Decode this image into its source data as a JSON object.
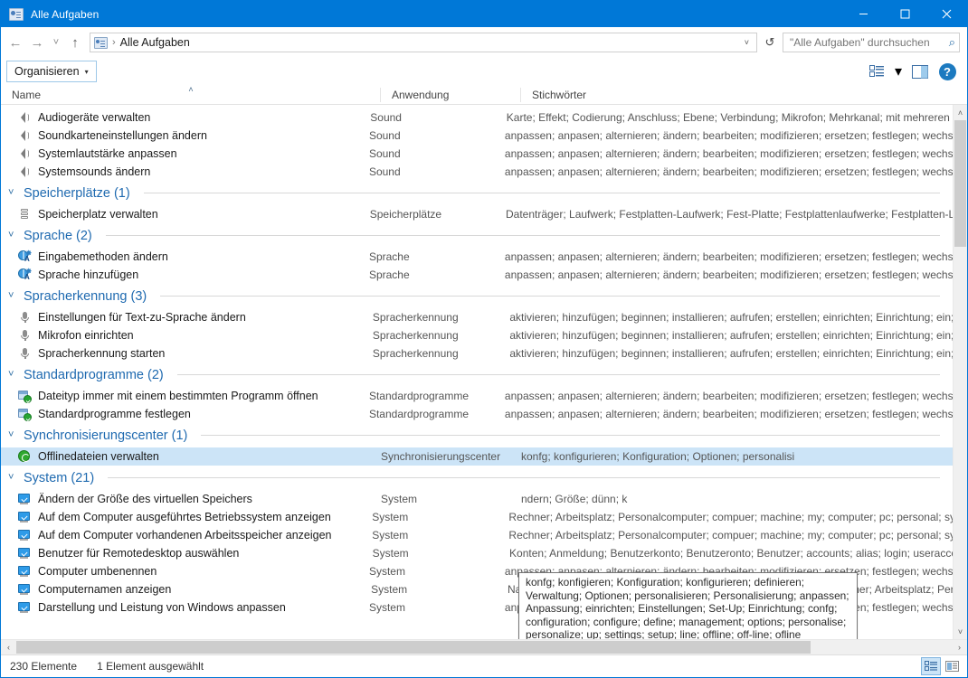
{
  "window": {
    "title": "Alle Aufgaben",
    "icon": "task-list-icon",
    "accent": "#0078d7",
    "minimize": "–",
    "maximize": "□",
    "close": "✕"
  },
  "addressbar": {
    "back": "←",
    "forward": "→",
    "recent": "˅",
    "up": "↑",
    "breadcrumb_icon": "task-list-icon",
    "separator": "›",
    "path": "Alle Aufgaben",
    "dropdown": "˅",
    "refresh": "↺",
    "search_placeholder": "\"Alle Aufgaben\" durchsuchen",
    "search_value": "",
    "search_icon": "⌕"
  },
  "toolbar": {
    "organize_label": "Organisieren",
    "organize_caret": "▾",
    "view_icon": "view-options-icon",
    "view_caret": "▾",
    "preview_icon": "preview-pane-icon",
    "help_icon": "?"
  },
  "columns": [
    {
      "label": "Name",
      "sorted": true,
      "sort_arrow": "˄"
    },
    {
      "label": "Anwendung",
      "sorted": false,
      "sort_arrow": ""
    },
    {
      "label": "Stichwörter",
      "sorted": false,
      "sort_arrow": ""
    }
  ],
  "chevron_group": "˅",
  "groups": [
    {
      "label": "",
      "header": false,
      "rows": [
        {
          "icon": "speaker",
          "name": "Audiogeräte verwalten",
          "app": "Sound",
          "keywords": "Karte; Effekt; Codierung; Anschluss; Ebene; Verbindung; Mikrofon; Mehrkanal; mit mehreren Kä"
        },
        {
          "icon": "speaker",
          "name": "Soundkarteneinstellungen ändern",
          "app": "Sound",
          "keywords": "anpassen; anpasen; alternieren; ändern; bearbeiten; modifizieren; ersetzen; festlegen; wechseln"
        },
        {
          "icon": "speaker",
          "name": "Systemlautstärke anpassen",
          "app": "Sound",
          "keywords": "anpassen; anpasen; alternieren; ändern; bearbeiten; modifizieren; ersetzen; festlegen; wechseln"
        },
        {
          "icon": "speaker",
          "name": "Systemsounds ändern",
          "app": "Sound",
          "keywords": "anpassen; anpasen; alternieren; ändern; bearbeiten; modifizieren; ersetzen; festlegen; wechseln"
        }
      ]
    },
    {
      "label": "Speicherplätze (1)",
      "header": true,
      "rows": [
        {
          "icon": "drive",
          "name": "Speicherplatz verwalten",
          "app": "Speicherplätze",
          "keywords": "Datenträger; Laufwerk; Festplatten-Laufwerk; Fest-Platte; Festplattenlaufwerke; Festplatten-Lau"
        }
      ]
    },
    {
      "label": "Sprache (2)",
      "header": true,
      "rows": [
        {
          "icon": "lang",
          "name": "Eingabemethoden ändern",
          "app": "Sprache",
          "keywords": "anpassen; anpasen; alternieren; ändern; bearbeiten; modifizieren; ersetzen; festlegen; wechseln"
        },
        {
          "icon": "lang",
          "name": "Sprache hinzufügen",
          "app": "Sprache",
          "keywords": "anpassen; anpasen; alternieren; ändern; bearbeiten; modifizieren; ersetzen; festlegen; wechseln"
        }
      ]
    },
    {
      "label": "Spracherkennung (3)",
      "header": true,
      "rows": [
        {
          "icon": "mic",
          "name": "Einstellungen für Text-zu-Sprache ändern",
          "app": "Spracherkennung",
          "keywords": "aktivieren; hinzufügen; beginnen; installieren; aufrufen; erstellen; einrichten; Einrichtung; ein; a"
        },
        {
          "icon": "mic",
          "name": "Mikrofon einrichten",
          "app": "Spracherkennung",
          "keywords": "aktivieren; hinzufügen; beginnen; installieren; aufrufen; erstellen; einrichten; Einrichtung; ein; a"
        },
        {
          "icon": "mic",
          "name": "Spracherkennung starten",
          "app": "Spracherkennung",
          "keywords": "aktivieren; hinzufügen; beginnen; installieren; aufrufen; erstellen; einrichten; Einrichtung; ein; a"
        }
      ]
    },
    {
      "label": "Standardprogramme (2)",
      "header": true,
      "rows": [
        {
          "icon": "defprog",
          "name": "Dateityp immer mit einem bestimmten Programm öffnen",
          "app": "Standardprogramme",
          "keywords": "anpassen; anpasen; alternieren; ändern; bearbeiten; modifizieren; ersetzen; festlegen; wechseln"
        },
        {
          "icon": "defprog",
          "name": "Standardprogramme festlegen",
          "app": "Standardprogramme",
          "keywords": "anpassen; anpasen; alternieren; ändern; bearbeiten; modifizieren; ersetzen; festlegen; wechseln"
        }
      ]
    },
    {
      "label": "Synchronisierungscenter (1)",
      "header": true,
      "rows": [
        {
          "icon": "sync",
          "name": "Offlinedateien verwalten",
          "app": "Synchronisierungscenter",
          "keywords": "konfg; konfigurieren; Konfiguration; Optionen; personalisi",
          "selected": true
        }
      ]
    },
    {
      "label": "System (21)",
      "header": true,
      "rows": [
        {
          "icon": "sysmon",
          "name": "Ändern der Größe des virtuellen Speichers",
          "app": "System",
          "keywords": "ndern; Größe; dünn; k"
        },
        {
          "icon": "sysmon",
          "name": "Auf dem Computer ausgeführtes Betriebssystem anzeigen",
          "app": "System",
          "keywords": "Rechner; Arbeitsplatz; Personalcomputer; compuer; machine; my; computer; pc; personal; syst"
        },
        {
          "icon": "sysmon",
          "name": "Auf dem Computer vorhandenen Arbeitsspeicher anzeigen",
          "app": "System",
          "keywords": "Rechner; Arbeitsplatz; Personalcomputer; compuer; machine; my; computer; pc; personal; syst"
        },
        {
          "icon": "sysmon",
          "name": "Benutzer für Remotedesktop auswählen",
          "app": "System",
          "keywords": "Konten; Anmeldung; Benutzerkonto; Benutzeronto; Benutzer; accounts; alias; login; useraccou"
        },
        {
          "icon": "sysmon",
          "name": "Computer umbenennen",
          "app": "System",
          "keywords": "anpassen; anpasen; alternieren; ändern; bearbeiten; modifizieren; ersetzen; festlegen; wechseln"
        },
        {
          "icon": "sysmon",
          "name": "Computernamen anzeigen",
          "app": "System",
          "keywords": "Namen; umbenennen; Umbenennung; names; rename; renaming; Rechner; Arbeitsplatz; Persc"
        },
        {
          "icon": "sysmon",
          "name": "Darstellung und Leistung von Windows anpassen",
          "app": "System",
          "keywords": "anpassen; anpasen; alternieren; ändern; bearbeiten; modifizieren; ersetzen; festlegen; wechseln"
        }
      ]
    }
  ],
  "tooltip": {
    "text": "konfg; konfigieren; Konfiguration; konfigurieren; definieren; Verwaltung; Optionen; personalisieren; Personalisierung; anpassen; Anpassung; einrichten; Einstellungen; Set-Up; Einrichtung; confg; configuration; configure; define; management; options; personalise; personalize; up; settings; setup; line; offline; off-line; ofline"
  },
  "scrollbars": {
    "v_up": "˄",
    "v_down": "˅",
    "h_left": "‹",
    "h_right": "›"
  },
  "statusbar": {
    "item_count": "230 Elemente",
    "selection": "1 Element ausgewählt",
    "details_view_icon": "details-view-icon",
    "content_view_icon": "content-view-icon"
  }
}
